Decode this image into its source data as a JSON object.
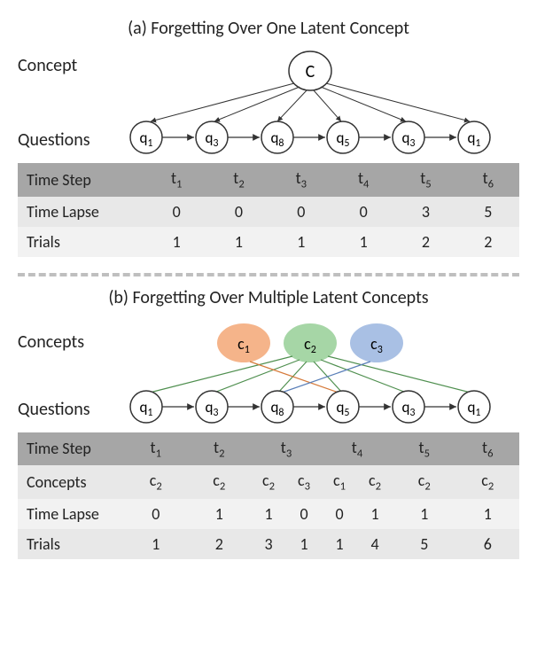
{
  "partA": {
    "title": "(a) Forgetting  Over One Latent Concept",
    "conceptLabel": "Concept",
    "conceptNode": "C",
    "questionsLabel": "Questions",
    "qSeq": [
      "q1",
      "q3",
      "q8",
      "q5",
      "q3",
      "q1"
    ],
    "rows": {
      "timestepLabel": "Time Step",
      "timesteps": [
        "t1",
        "t2",
        "t3",
        "t4",
        "t5",
        "t6"
      ],
      "timelapseLabel": "Time Lapse",
      "timelapse": [
        "0",
        "0",
        "0",
        "0",
        "3",
        "5"
      ],
      "trialsLabel": "Trials",
      "trials": [
        "1",
        "1",
        "1",
        "1",
        "2",
        "2"
      ]
    }
  },
  "partB": {
    "title": "(b) Forgetting Over Multiple Latent Concepts",
    "conceptsLabel": "Concepts",
    "conceptNodes": [
      "c1",
      "c2",
      "c3"
    ],
    "questionsLabel": "Questions",
    "qSeq": [
      "q1",
      "q3",
      "q8",
      "q5",
      "q3",
      "q1"
    ],
    "rows": {
      "timestepLabel": "Time Step",
      "timesteps": [
        "t1",
        "t2",
        "t3",
        "t4",
        "t5",
        "t6"
      ],
      "conceptsLabel": "Concepts",
      "conceptsRow": [
        "c2",
        "c2",
        "c2 c3",
        "c1 c2",
        "c2",
        "c2"
      ],
      "conceptsRowT3a": "c2",
      "conceptsRowT3b": "c3",
      "conceptsRowT4a": "c1",
      "conceptsRowT4b": "c2",
      "timelapseLabel": "Time Lapse",
      "timelapseRow": [
        "0",
        "1",
        "1 0",
        "0 1",
        "1",
        "1"
      ],
      "timelapseT3a": "1",
      "timelapseT3b": "0",
      "timelapseT4a": "0",
      "timelapseT4b": "1",
      "trialsLabel": "Trials",
      "trialsRow": [
        "1",
        "2",
        "3 1",
        "1 4",
        "5",
        "6"
      ],
      "trialsT3a": "3",
      "trialsT3b": "1",
      "trialsT4a": "1",
      "trialsT4b": "4"
    }
  },
  "chart_data": {
    "type": "table",
    "partA": {
      "timesteps": [
        "t1",
        "t2",
        "t3",
        "t4",
        "t5",
        "t6"
      ],
      "questions": [
        "q1",
        "q3",
        "q8",
        "q5",
        "q3",
        "q1"
      ],
      "time_lapse": [
        0,
        0,
        0,
        0,
        3,
        5
      ],
      "trials": [
        1,
        1,
        1,
        1,
        2,
        2
      ]
    },
    "partB": {
      "timesteps": [
        "t1",
        "t2",
        "t3",
        "t4",
        "t5",
        "t6"
      ],
      "questions": [
        "q1",
        "q3",
        "q8",
        "q5",
        "q3",
        "q1"
      ],
      "concepts_per_step": [
        [
          "c2"
        ],
        [
          "c2"
        ],
        [
          "c2",
          "c3"
        ],
        [
          "c1",
          "c2"
        ],
        [
          "c2"
        ],
        [
          "c2"
        ]
      ],
      "time_lapse_per_step": [
        [
          0
        ],
        [
          1
        ],
        [
          1,
          0
        ],
        [
          0,
          1
        ],
        [
          1
        ],
        [
          1
        ]
      ],
      "trials_per_step": [
        [
          1
        ],
        [
          2
        ],
        [
          3,
          1
        ],
        [
          1,
          4
        ],
        [
          5
        ],
        [
          6
        ]
      ],
      "concept_colors": {
        "c1": "#f5a77b",
        "c2": "#9fd49f",
        "c3": "#9fb9e0"
      }
    }
  }
}
